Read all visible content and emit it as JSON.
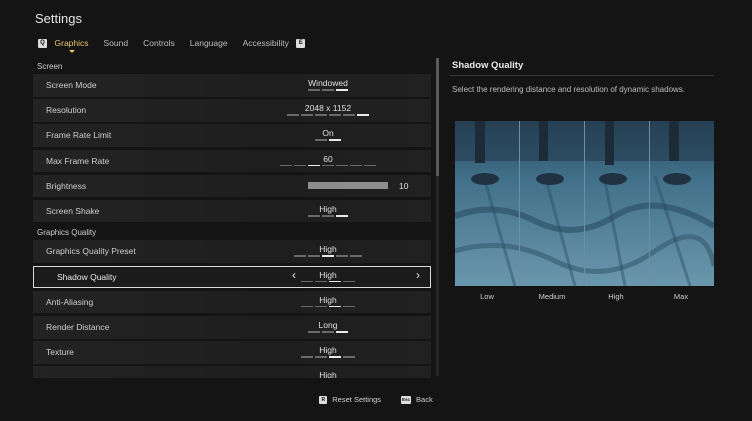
{
  "header": {
    "title": "Settings"
  },
  "tabs": {
    "left_key": "Q",
    "right_key": "E",
    "items": [
      {
        "label": "Graphics",
        "active": true
      },
      {
        "label": "Sound",
        "active": false
      },
      {
        "label": "Controls",
        "active": false
      },
      {
        "label": "Language",
        "active": false
      },
      {
        "label": "Accessibility",
        "active": false
      }
    ]
  },
  "sections": [
    {
      "title": "Screen",
      "rows": [
        {
          "label": "Screen Mode",
          "value": "Windowed",
          "options": 3,
          "selected": 3
        },
        {
          "label": "Resolution",
          "value": "2048 x 1152",
          "options": 6,
          "selected": 6
        },
        {
          "label": "Frame Rate Limit",
          "value": "On",
          "options": 2,
          "selected": 2
        },
        {
          "label": "Max Frame Rate",
          "value": "60",
          "options": 7,
          "selected": 3
        },
        {
          "label": "Brightness",
          "value": "10",
          "type": "slider",
          "level": 1.0
        },
        {
          "label": "Screen Shake",
          "value": "High",
          "options": 3,
          "selected": 3
        }
      ]
    },
    {
      "title": "Graphics Quality",
      "rows": [
        {
          "label": "Graphics Quality Preset",
          "value": "High",
          "options": 5,
          "selected": 3
        },
        {
          "label": "Shadow Quality",
          "value": "High",
          "options": 4,
          "selected": 3,
          "highlighted": true
        },
        {
          "label": "Anti-Aliasing",
          "value": "High",
          "options": 4,
          "selected": 3
        },
        {
          "label": "Render Distance",
          "value": "Long",
          "options": 3,
          "selected": 3
        },
        {
          "label": "Texture",
          "value": "High",
          "options": 4,
          "selected": 3
        },
        {
          "label": "",
          "value": "High",
          "options": 4,
          "selected": 3
        }
      ]
    }
  ],
  "details": {
    "title": "Shadow Quality",
    "description": "Select the rendering distance and resolution of dynamic shadows.",
    "quality_labels": [
      "Low",
      "Medium",
      "High",
      "Max"
    ]
  },
  "footer": {
    "reset_key": "R",
    "reset_label": "Reset Settings",
    "back_key": "Esc",
    "back_label": "Back"
  },
  "colors": {
    "accent": "#e7c76a",
    "background": "#141414",
    "row": "#222222"
  }
}
